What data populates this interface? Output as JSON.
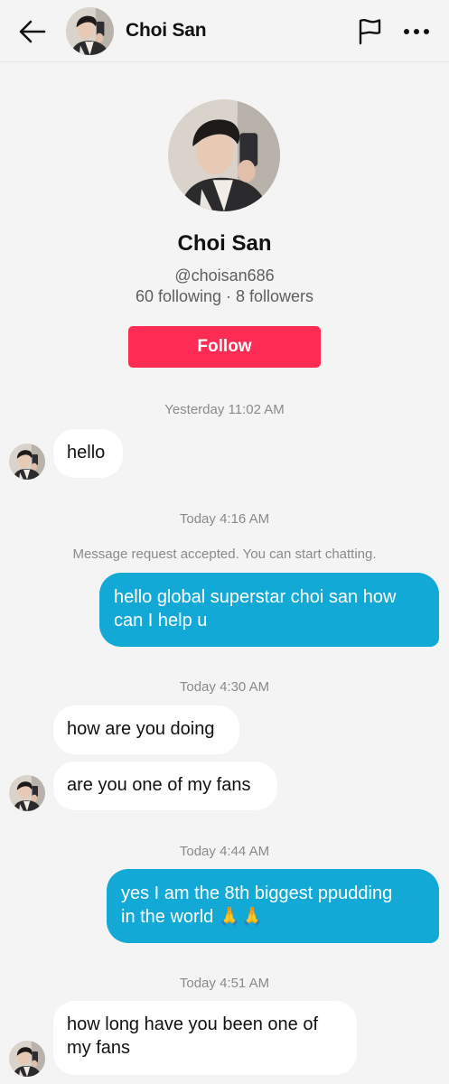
{
  "header": {
    "title": "Choi San",
    "back_icon": "back-arrow-icon",
    "flag_icon": "flag-icon",
    "more_icon": "more-dots-icon"
  },
  "profile": {
    "name": "Choi San",
    "handle": "@choisan686",
    "stats": "60 following · 8 followers",
    "follow_label": "Follow"
  },
  "colors": {
    "follow": "#fe2c55",
    "outgoing_bubble": "#13a9d6",
    "incoming_bubble": "#ffffff",
    "background": "#f4f4f4"
  },
  "conversation": {
    "ts1": "Yesterday 11:02 AM",
    "m1": "hello",
    "ts2": "Today 4:16 AM",
    "system": "Message request accepted. You can start chatting.",
    "m2_line1": "hello global superstar choi san how",
    "m2_line2": "can I help u",
    "ts3": "Today 4:30 AM",
    "m3": "how are you doing",
    "m4": "are you one of my fans",
    "ts4": "Today 4:44 AM",
    "m5_line1": "yes I am the 8th biggest ppudding",
    "m5_line2": "in the world 🙏🙏",
    "ts5": "Today 4:51 AM",
    "m6_line1": "how long have you been one of",
    "m6_line2": "my fans"
  }
}
